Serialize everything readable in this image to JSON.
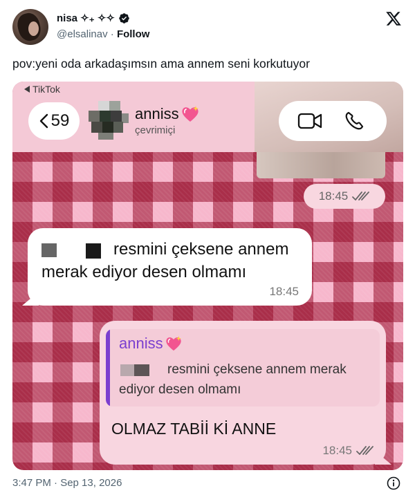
{
  "tweet": {
    "display_name": "nisa ✧₊ ✧✧",
    "handle": "@elsalinav",
    "separator": " · ",
    "follow_label": "Follow",
    "text": "pov:yeni oda arkadaşımsın ama annem seni korkutuyor",
    "timestamp": "3:47 PM · Sep 13, 2026"
  },
  "screenshot": {
    "source_label": "TikTok",
    "back_count": "59",
    "contact_name": "anniss",
    "contact_status": "çevrimiçi",
    "top_message_time": "18:45",
    "incoming_message": {
      "text": "resmini çeksene annem merak ediyor desen olmamı",
      "time": "18:45"
    },
    "outgoing_message": {
      "quoted_name": "anniss",
      "quoted_text": "resmini çeksene annem merak ediyor desen olmamı",
      "text": "OLMAZ TABİİ Kİ ANNE",
      "time": "18:45"
    }
  },
  "icons": [
    "verified-badge-icon",
    "x-logo-icon",
    "back-chevron-icon",
    "video-call-icon",
    "phone-icon",
    "sparkling-heart-icon",
    "double-check-icon",
    "info-icon"
  ],
  "colors": {
    "check_pattern_dark": "#8b1030",
    "check_pattern_light": "#f7b7cc",
    "outgoing_bubble": "#f8d6e0",
    "quote_name": "#7b3fcf",
    "verified_blue": "#1d9bf0"
  }
}
